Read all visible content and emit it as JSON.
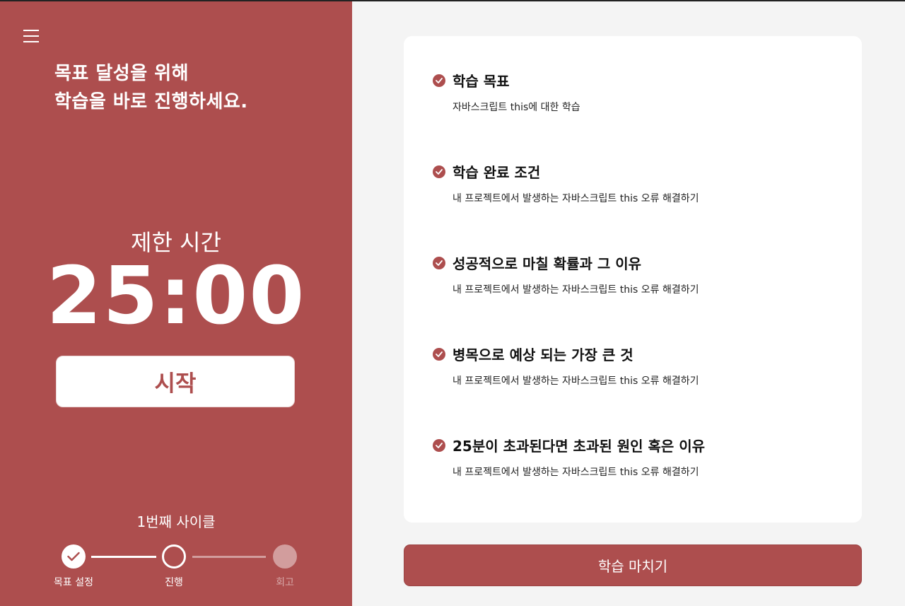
{
  "left": {
    "headline_line1": "목표 달성을 위해",
    "headline_line2": "학습을 바로 진행하세요.",
    "limit_label": "제한 시간",
    "timer": "25:00",
    "start_label": "시작",
    "cycle_label": "1번째 사이클",
    "steps": [
      {
        "label": "목표 설정",
        "state": "done"
      },
      {
        "label": "진행",
        "state": "current"
      },
      {
        "label": "회고",
        "state": "upcoming"
      }
    ]
  },
  "goals": {
    "items": [
      {
        "title": "학습 목표",
        "desc": "자바스크립트 this에 대한 학습"
      },
      {
        "title": "학습 완료 조건",
        "desc": "내 프로젝트에서 발생하는 자바스크립트 this 오류 해결하기"
      },
      {
        "title": "성공적으로 마칠 확률과 그 이유",
        "desc": "내 프로젝트에서 발생하는 자바스크립트 this 오류 해결하기"
      },
      {
        "title": "병목으로 예상 되는 가장 큰 것",
        "desc": "내 프로젝트에서 발생하는 자바스크립트 this 오류 해결하기"
      },
      {
        "title": "25분이 초과된다면 초과된 원인 혹은 이유",
        "desc": "내 프로젝트에서 발생하는 자바스크립트 this 오류 해결하기"
      }
    ]
  },
  "finish_label": "학습 마치기",
  "colors": {
    "accent": "#ad4e4e",
    "background": "#f4f4f4",
    "card": "#ffffff"
  },
  "icons": {
    "menu": "hamburger-icon",
    "check": "check-circle-icon"
  }
}
